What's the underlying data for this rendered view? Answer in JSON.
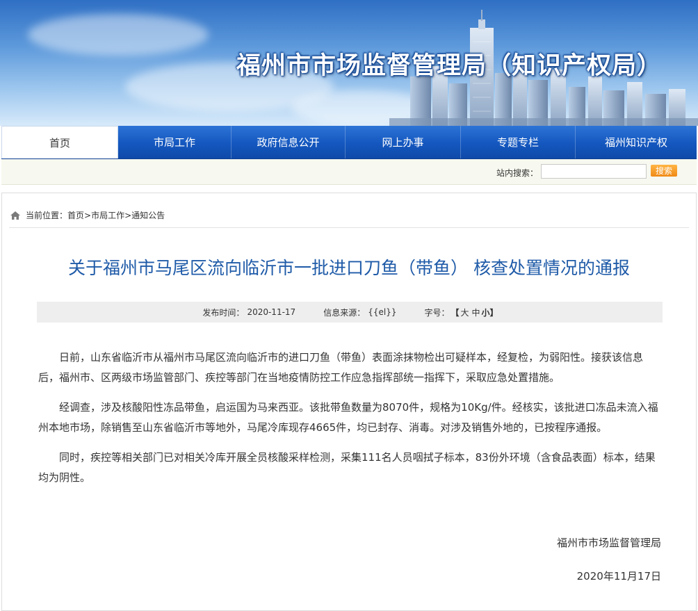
{
  "site": {
    "title": "福州市市场监督管理局（知识产权局）"
  },
  "nav": {
    "items": [
      {
        "label": "首页"
      },
      {
        "label": "市局工作"
      },
      {
        "label": "政府信息公开"
      },
      {
        "label": "网上办事"
      },
      {
        "label": "专题专栏"
      },
      {
        "label": "福州知识产权"
      }
    ]
  },
  "search": {
    "label": "站内搜索：",
    "placeholder": "",
    "button": "搜索"
  },
  "breadcrumb": {
    "prefix": "当前位置：",
    "crumbs": [
      "首页",
      "市局工作",
      "通知公告"
    ],
    "separator": ">"
  },
  "article": {
    "title": "关于福州市马尾区流向临沂市一批进口刀鱼（带鱼） 核查处置情况的通报",
    "meta": {
      "date_label": "发布时间：",
      "date": "2020-11-17",
      "source_label": "信息来源：",
      "source": "{{el}}",
      "font_label": "字号：",
      "font_open": "【",
      "font_large": "大",
      "font_medium": "中",
      "font_small": "小",
      "font_close": "】"
    },
    "paragraphs": [
      "日前，山东省临沂市从福州市马尾区流向临沂市的进口刀鱼（带鱼）表面涂抹物检出可疑样本，经复检，为弱阳性。接获该信息后，福州市、区两级市场监管部门、疾控等部门在当地疫情防控工作应急指挥部统一指挥下，采取应急处置措施。",
      "经调查，涉及核酸阳性冻品带鱼，启运国为马来西亚。该批带鱼数量为8070件，规格为10Kg/件。经核实，该批进口冻品未流入福州本地市场，除销售至山东省临沂市等地外，马尾冷库现存4665件，均已封存、消毒。对涉及销售外地的，已按程序通报。",
      "同时，疾控等相关部门已对相关冷库开展全员核酸采样检测，采集111名人员咽拭子标本，83份外环境（含食品表面）标本，结果均为阴性。"
    ],
    "signature": "福州市市场监督管理局",
    "sign_date": "2020年11月17日"
  },
  "colors": {
    "nav": "#1457bf",
    "title": "#1f5ba8",
    "search_button": "#f08a16"
  }
}
